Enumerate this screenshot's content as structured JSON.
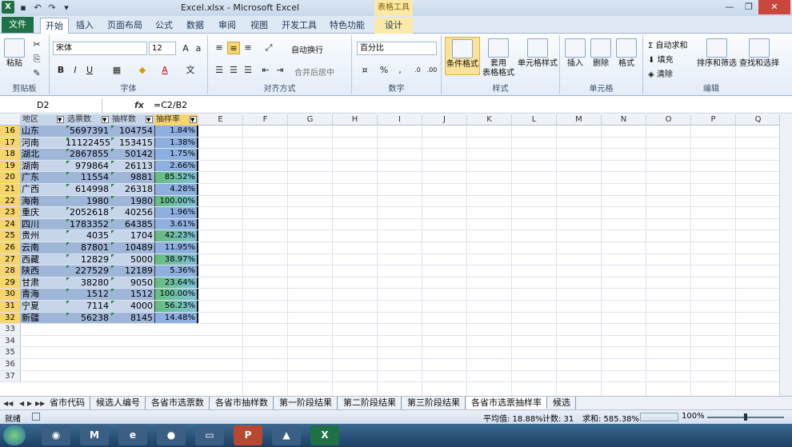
{
  "window": {
    "title": "Excel.xlsx - Microsoft Excel",
    "contextual": "表格工具"
  },
  "ribbon_tabs": [
    "开始",
    "插入",
    "页面布局",
    "公式",
    "数据",
    "审阅",
    "视图",
    "开发工具",
    "特色功能"
  ],
  "file_tab": "文件",
  "design_tab": "设计",
  "clipboard": {
    "paste": "粘贴",
    "label": "剪贴板"
  },
  "font": {
    "name": "宋体",
    "size": "12",
    "label": "字体"
  },
  "alignment": {
    "wrap": "自动换行",
    "merge": "合并后居中",
    "label": "对齐方式"
  },
  "number": {
    "format": "百分比",
    "label": "数字"
  },
  "styles": {
    "cond": "条件格式",
    "table_fmt_1": "套用",
    "table_fmt_2": "表格格式",
    "cell_style": "单元格样式",
    "label": "样式"
  },
  "cells": {
    "insert": "插入",
    "delete": "删除",
    "format": "格式",
    "label": "单元格"
  },
  "editing": {
    "autosum": "自动求和",
    "fill": "填充",
    "clear": "清除",
    "sort": "排序和筛选",
    "find": "查找和选择",
    "label": "编辑"
  },
  "formula_bar": {
    "name_box": "D2",
    "fx": "fx",
    "formula": "=C2/B2"
  },
  "columns": [
    "E",
    "F",
    "G",
    "H",
    "I",
    "J",
    "K",
    "L",
    "M",
    "N",
    "O",
    "P",
    "Q"
  ],
  "headers": {
    "a": "地区",
    "b": "选票数",
    "c": "抽样数",
    "d": "抽样率"
  },
  "rows": [
    {
      "n": "16",
      "a": "山东",
      "b": "5697391",
      "c": "104754",
      "d": "1.84%"
    },
    {
      "n": "17",
      "a": "河南",
      "b": "11122455",
      "c": "153415",
      "d": "1.38%"
    },
    {
      "n": "18",
      "a": "湖北",
      "b": "2867855",
      "c": "50142",
      "d": "1.75%"
    },
    {
      "n": "19",
      "a": "湖南",
      "b": "979864",
      "c": "26113",
      "d": "2.66%"
    },
    {
      "n": "20",
      "a": "广东",
      "b": "11554",
      "c": "9881",
      "d": "85.52%"
    },
    {
      "n": "21",
      "a": "广西",
      "b": "614998",
      "c": "26318",
      "d": "4.28%"
    },
    {
      "n": "22",
      "a": "海南",
      "b": "1980",
      "c": "1980",
      "d": "100.00%"
    },
    {
      "n": "23",
      "a": "重庆",
      "b": "2052618",
      "c": "40256",
      "d": "1.96%"
    },
    {
      "n": "24",
      "a": "四川",
      "b": "1783352",
      "c": "64385",
      "d": "3.61%"
    },
    {
      "n": "25",
      "a": "贵州",
      "b": "4035",
      "c": "1704",
      "d": "42.23%"
    },
    {
      "n": "26",
      "a": "云南",
      "b": "87801",
      "c": "10489",
      "d": "11.95%"
    },
    {
      "n": "27",
      "a": "西藏",
      "b": "12829",
      "c": "5000",
      "d": "38.97%"
    },
    {
      "n": "28",
      "a": "陕西",
      "b": "227529",
      "c": "12189",
      "d": "5.36%"
    },
    {
      "n": "29",
      "a": "甘肃",
      "b": "38280",
      "c": "9050",
      "d": "23.64%"
    },
    {
      "n": "30",
      "a": "青海",
      "b": "1512",
      "c": "1512",
      "d": "100.00%"
    },
    {
      "n": "31",
      "a": "宁夏",
      "b": "7114",
      "c": "4000",
      "d": "56.23%"
    },
    {
      "n": "32",
      "a": "新疆",
      "b": "56238",
      "c": "8145",
      "d": "14.48%"
    }
  ],
  "empty_rows": [
    "33",
    "34",
    "35",
    "36",
    "37"
  ],
  "sheets": [
    "省市代码",
    "候选人编号",
    "各省市选票数",
    "各省市抽样数",
    "第一阶段结果",
    "第二阶段结果",
    "第三阶段结果",
    "各省市选票抽样率",
    "候选"
  ],
  "active_sheet": "各省市选票抽样率",
  "status": {
    "ready": "就绪",
    "average": "平均值: 18.88%",
    "count": "计数: 31",
    "sum": "求和: 585.38%",
    "zoom": "100%"
  },
  "colors": {
    "file": "#1e7145",
    "band1": "#9fb6d9",
    "band2": "#c6d5ea",
    "green": "#63be7b"
  }
}
